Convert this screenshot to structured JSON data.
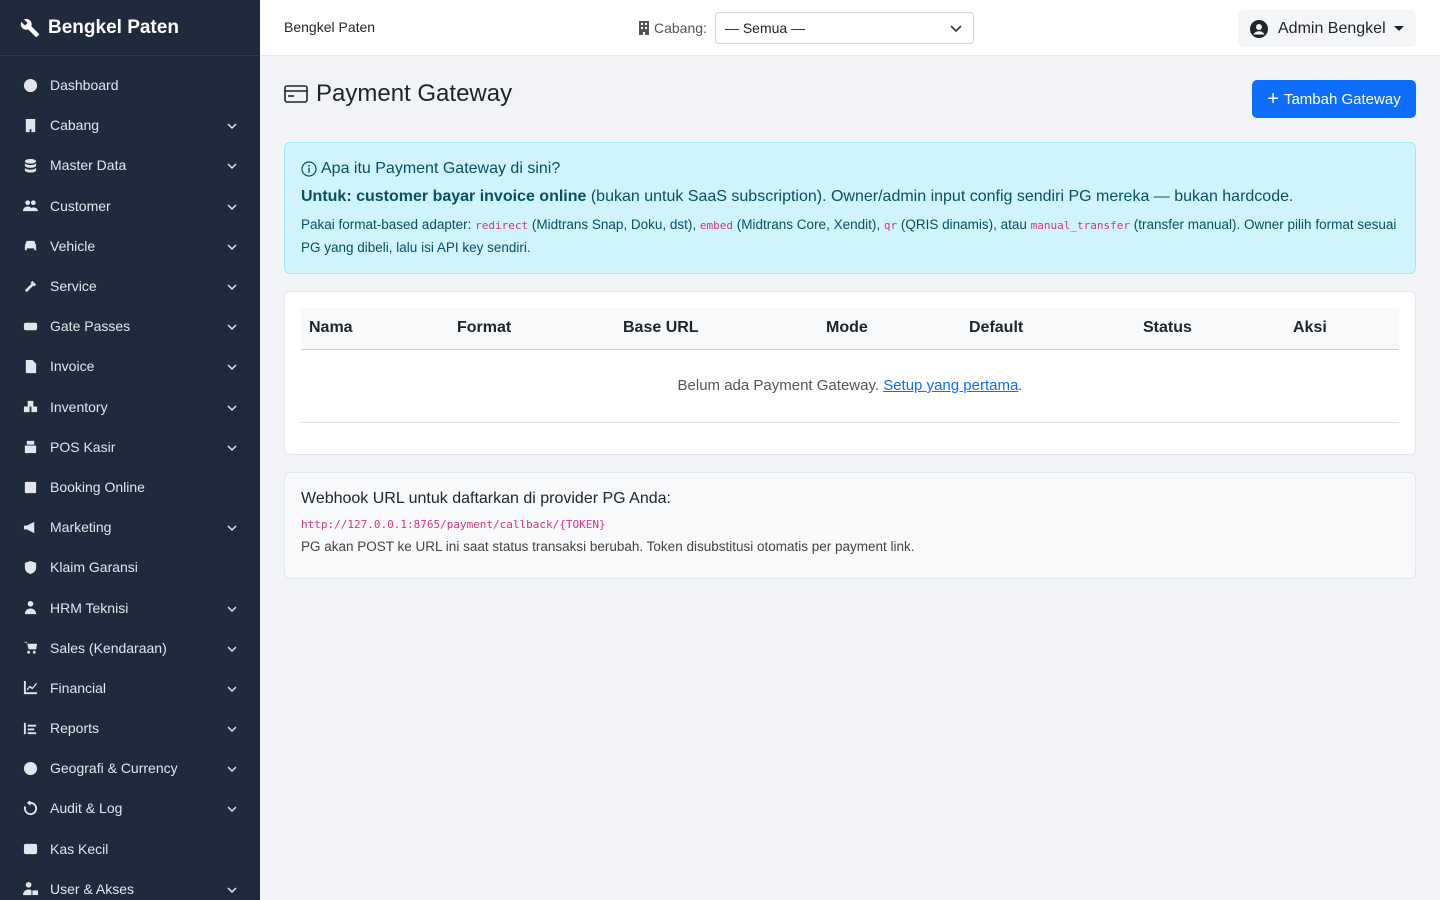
{
  "sidebar": {
    "brand": "Bengkel Paten",
    "items": [
      {
        "label": "Dashboard",
        "icon": "dashboard-icon",
        "expandable": false
      },
      {
        "label": "Cabang",
        "icon": "building-icon",
        "expandable": true
      },
      {
        "label": "Master Data",
        "icon": "database-icon",
        "expandable": true
      },
      {
        "label": "Customer",
        "icon": "users-icon",
        "expandable": true
      },
      {
        "label": "Vehicle",
        "icon": "car-icon",
        "expandable": true
      },
      {
        "label": "Service",
        "icon": "tools-icon",
        "expandable": true
      },
      {
        "label": "Gate Passes",
        "icon": "ticket-icon",
        "expandable": true
      },
      {
        "label": "Invoice",
        "icon": "file-icon",
        "expandable": true
      },
      {
        "label": "Inventory",
        "icon": "boxes-icon",
        "expandable": true
      },
      {
        "label": "POS Kasir",
        "icon": "cash-register-icon",
        "expandable": true
      },
      {
        "label": "Booking Online",
        "icon": "calendar-icon",
        "expandable": false
      },
      {
        "label": "Marketing",
        "icon": "megaphone-icon",
        "expandable": true
      },
      {
        "label": "Klaim Garansi",
        "icon": "shield-icon",
        "expandable": false
      },
      {
        "label": "HRM Teknisi",
        "icon": "user-tie-icon",
        "expandable": true
      },
      {
        "label": "Sales (Kendaraan)",
        "icon": "cart-icon",
        "expandable": true
      },
      {
        "label": "Financial",
        "icon": "chart-line-icon",
        "expandable": true
      },
      {
        "label": "Reports",
        "icon": "list-icon",
        "expandable": true
      },
      {
        "label": "Geografi & Currency",
        "icon": "globe-icon",
        "expandable": true
      },
      {
        "label": "Audit & Log",
        "icon": "history-icon",
        "expandable": true
      },
      {
        "label": "Kas Kecil",
        "icon": "wallet-icon",
        "expandable": false
      },
      {
        "label": "User & Akses",
        "icon": "user-lock-icon",
        "expandable": true
      }
    ]
  },
  "topbar": {
    "title": "Bengkel Paten",
    "branch_label": "Cabang:",
    "branch_value": "— Semua —",
    "user_name": "Admin Bengkel"
  },
  "page": {
    "title": "Payment Gateway",
    "add_button": "Tambah Gateway"
  },
  "info": {
    "heading": "Apa itu Payment Gateway di sini?",
    "line1_bold": "Untuk: customer bayar invoice online",
    "line1_rest": " (bukan untuk SaaS subscription). Owner/admin input config sendiri PG mereka — bukan hardcode.",
    "line2_a": "Pakai format-based adapter: ",
    "code_redirect": "redirect",
    "line2_b": " (Midtrans Snap, Doku, dst), ",
    "code_embed": "embed",
    "line2_c": " (Midtrans Core, Xendit), ",
    "code_qr": "qr",
    "line2_d": " (QRIS dinamis), atau ",
    "code_manual": "manual_transfer",
    "line2_e": " (transfer manual). Owner pilih format sesuai PG yang dibeli, lalu isi API key sendiri."
  },
  "table": {
    "columns": [
      "Nama",
      "Format",
      "Base URL",
      "Mode",
      "Default",
      "Status",
      "Aksi"
    ],
    "empty_text": "Belum ada Payment Gateway. ",
    "empty_link": "Setup yang pertama",
    "empty_end": "."
  },
  "webhook": {
    "heading": "Webhook URL untuk daftarkan di provider PG Anda:",
    "url": "http://127.0.0.1:8765/payment/callback/{TOKEN}",
    "note": "PG akan POST ke URL ini saat status transaksi berubah. Token disubstitusi otomatis per payment link."
  },
  "colors": {
    "sidebar_bg": "#1f2a3c",
    "primary": "#0d6efd",
    "info_bg": "#cff4fc",
    "code": "#d63384"
  }
}
